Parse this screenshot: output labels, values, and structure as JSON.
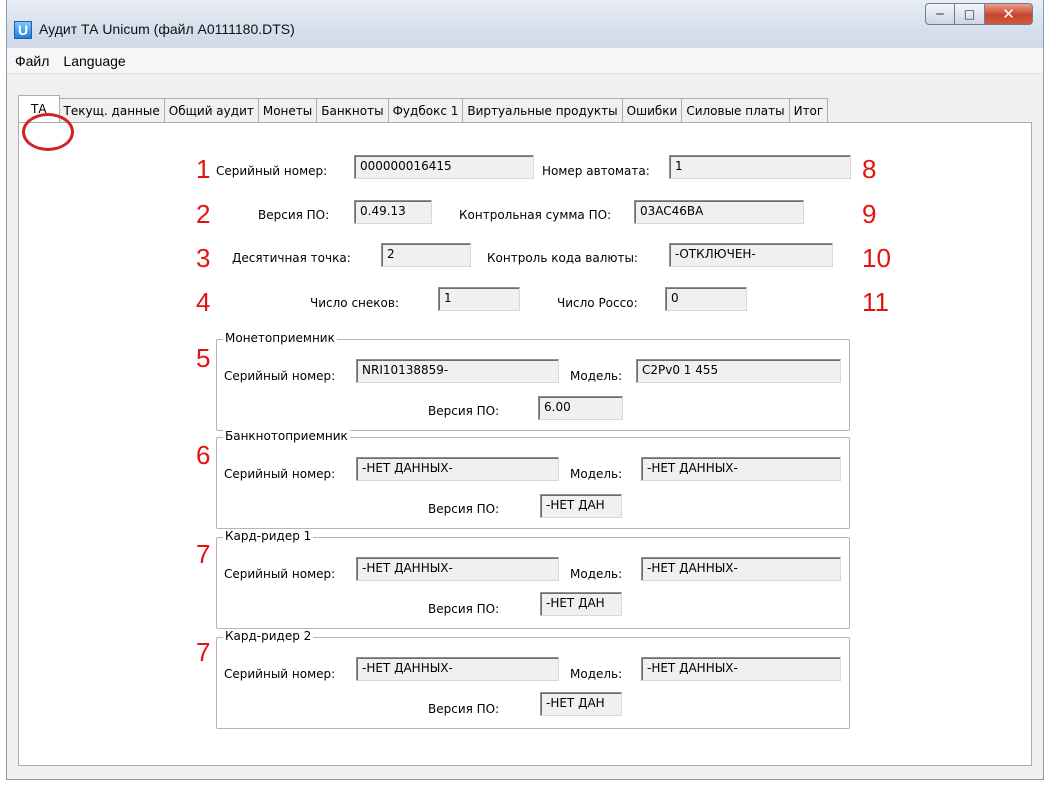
{
  "window": {
    "title": "Аудит ТА Unicum (файл A0111180.DTS)",
    "icon": "app-logo-icon"
  },
  "menu": [
    "Файл",
    "Language"
  ],
  "tabs": [
    "ТА",
    "Текущ. данные",
    "Общий аудит",
    "Монеты",
    "Банкноты",
    "Фудбокс 1",
    "Виртуальные продукты",
    "Ошибки",
    "Силовые платы",
    "Итог"
  ],
  "active_tab": "ТА",
  "annotation_color": "#e3130f",
  "fields": {
    "serial": {
      "label": "Серийный номер:",
      "value": "000000016415",
      "num": "1"
    },
    "firmware": {
      "label": "Версия ПО:",
      "value": "0.49.13",
      "num": "2"
    },
    "decimal_point": {
      "label": "Десятичная точка:",
      "value": "2",
      "num": "3"
    },
    "snacks": {
      "label": "Число снеков:",
      "value": "1",
      "num": "4"
    },
    "machine_no": {
      "label": "Номер автомата:",
      "value": "1",
      "num": "8"
    },
    "checksum": {
      "label": "Контрольная сумма ПО:",
      "value": "03AC46BA",
      "num": "9"
    },
    "currency_check": {
      "label": "Контроль кода валюты:",
      "value": "-ОТКЛЮЧЕН-",
      "num": "10"
    },
    "rocco": {
      "label": "Число Рocco:",
      "value": "0",
      "num": "11"
    }
  },
  "groups": [
    {
      "title": "Монетоприемник",
      "num": "5",
      "serial_label": "Серийный номер:",
      "serial": "NRI10138859-",
      "model_label": "Модель:",
      "model": "C2Pv0 1 455",
      "fw_label": "Версия ПО:",
      "fw": "6.00"
    },
    {
      "title": "Банкнотоприемник",
      "num": "6",
      "serial_label": "Серийный номер:",
      "serial": "-НЕТ ДАННЫХ-",
      "model_label": "Модель:",
      "model": "-НЕТ ДАННЫХ-",
      "fw_label": "Версия ПО:",
      "fw": "-НЕТ ДАН"
    },
    {
      "title": "Кард-ридер 1",
      "num": "7",
      "serial_label": "Серийный номер:",
      "serial": "-НЕТ ДАННЫХ-",
      "model_label": "Модель:",
      "model": "-НЕТ ДАННЫХ-",
      "fw_label": "Версия ПО:",
      "fw": "-НЕТ ДАН"
    },
    {
      "title": "Кард-ридер 2",
      "num": "7",
      "serial_label": "Серийный номер:",
      "serial": "-НЕТ ДАННЫХ-",
      "model_label": "Модель:",
      "model": "-НЕТ ДАННЫХ-",
      "fw_label": "Версия ПО:",
      "fw": "-НЕТ ДАН"
    }
  ]
}
